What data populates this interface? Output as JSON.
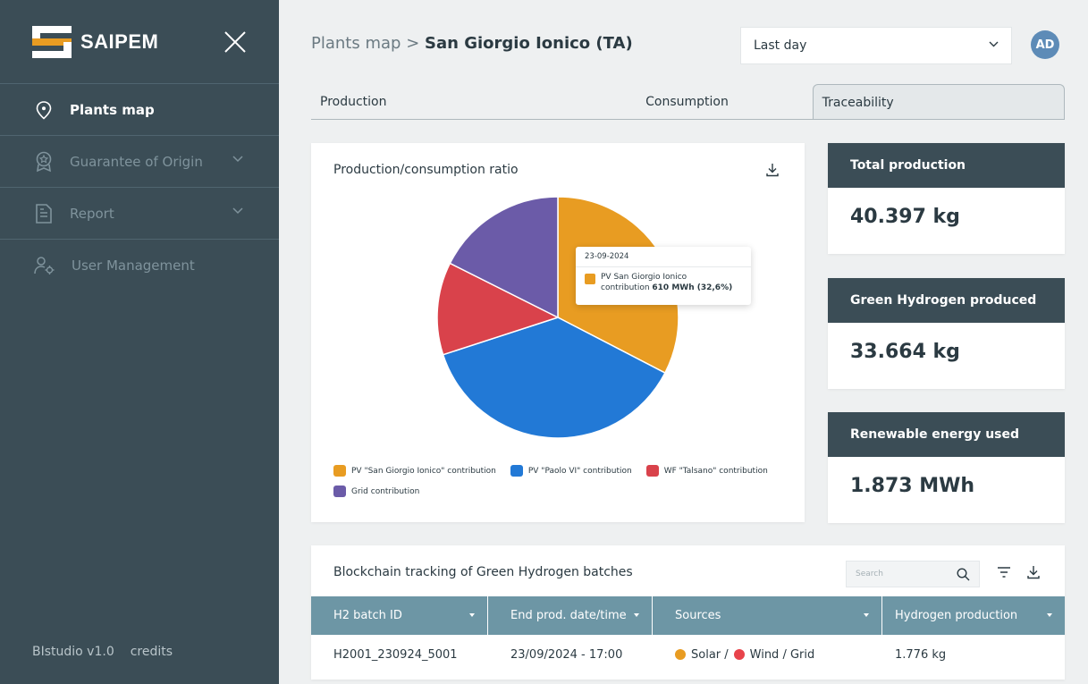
{
  "app": {
    "logo_text": "SAIPEM"
  },
  "sidebar": {
    "items": [
      {
        "label": "Plants map",
        "icon": "location-pin-icon"
      },
      {
        "label": "Guarantee of Origin",
        "icon": "badge-icon"
      },
      {
        "label": "Report",
        "icon": "document-icon"
      },
      {
        "label": "User Management",
        "icon": "user-settings-icon"
      }
    ],
    "footer": {
      "version": "BIstudio  v1.0",
      "credits": "credits"
    }
  },
  "header": {
    "breadcrumb_root": "Plants map",
    "breadcrumb_sep": ">",
    "breadcrumb_current": "San Giorgio Ionico (TA)",
    "period": "Last day",
    "avatar": "AD"
  },
  "tabs": [
    {
      "label": "Production"
    },
    {
      "label": "Consumption"
    },
    {
      "label": "Traceability",
      "active": true
    }
  ],
  "chart_card": {
    "title": "Production/consumption ratio",
    "tooltip": {
      "date": "23-09-2024",
      "line1": "PV San Giorgio Ionico",
      "line2_prefix": "contribution ",
      "line2_bold": "610 MWh (32,6%)"
    }
  },
  "chart_data": {
    "type": "pie",
    "title": "Production/consumption ratio",
    "slices": [
      {
        "label": "PV \"San Giorgio Ionico\" contribution",
        "value": 32.6,
        "color": "#e89c22"
      },
      {
        "label": "PV \"Paolo VI\" contribution",
        "value": 37.4,
        "color": "#2279d6"
      },
      {
        "label": "WF \"Talsano\" contribution",
        "value": 12.4,
        "color": "#d9424b"
      },
      {
        "label": "Grid contribution",
        "value": 17.6,
        "color": "#6b5ba8"
      }
    ],
    "legend": "bottom"
  },
  "kpis": [
    {
      "title": "Total production",
      "value": "40.397 kg"
    },
    {
      "title": "Green Hydrogen produced",
      "value": "33.664 kg"
    },
    {
      "title": "Renewable energy used",
      "value": "1.873 MWh"
    }
  ],
  "table": {
    "title": "Blockchain tracking of Green Hydrogen batches",
    "search_placeholder": "Search",
    "columns": [
      "H2 batch ID",
      "End prod. date/time",
      "Sources",
      "Hydrogen production"
    ],
    "rows": [
      {
        "batch_id": "H2001_230924_5001",
        "end_time": "23/09/2024 - 17:00",
        "sources": {
          "solar": "Solar /",
          "wind": "Wind / Grid"
        },
        "production": "1.776 kg"
      }
    ]
  },
  "colors": {
    "sidebar_bg": "#3b4d56",
    "table_header": "#6d96a5",
    "solar": "#e89c22",
    "wind": "#e8434b",
    "avatar": "#5d8bb7"
  }
}
